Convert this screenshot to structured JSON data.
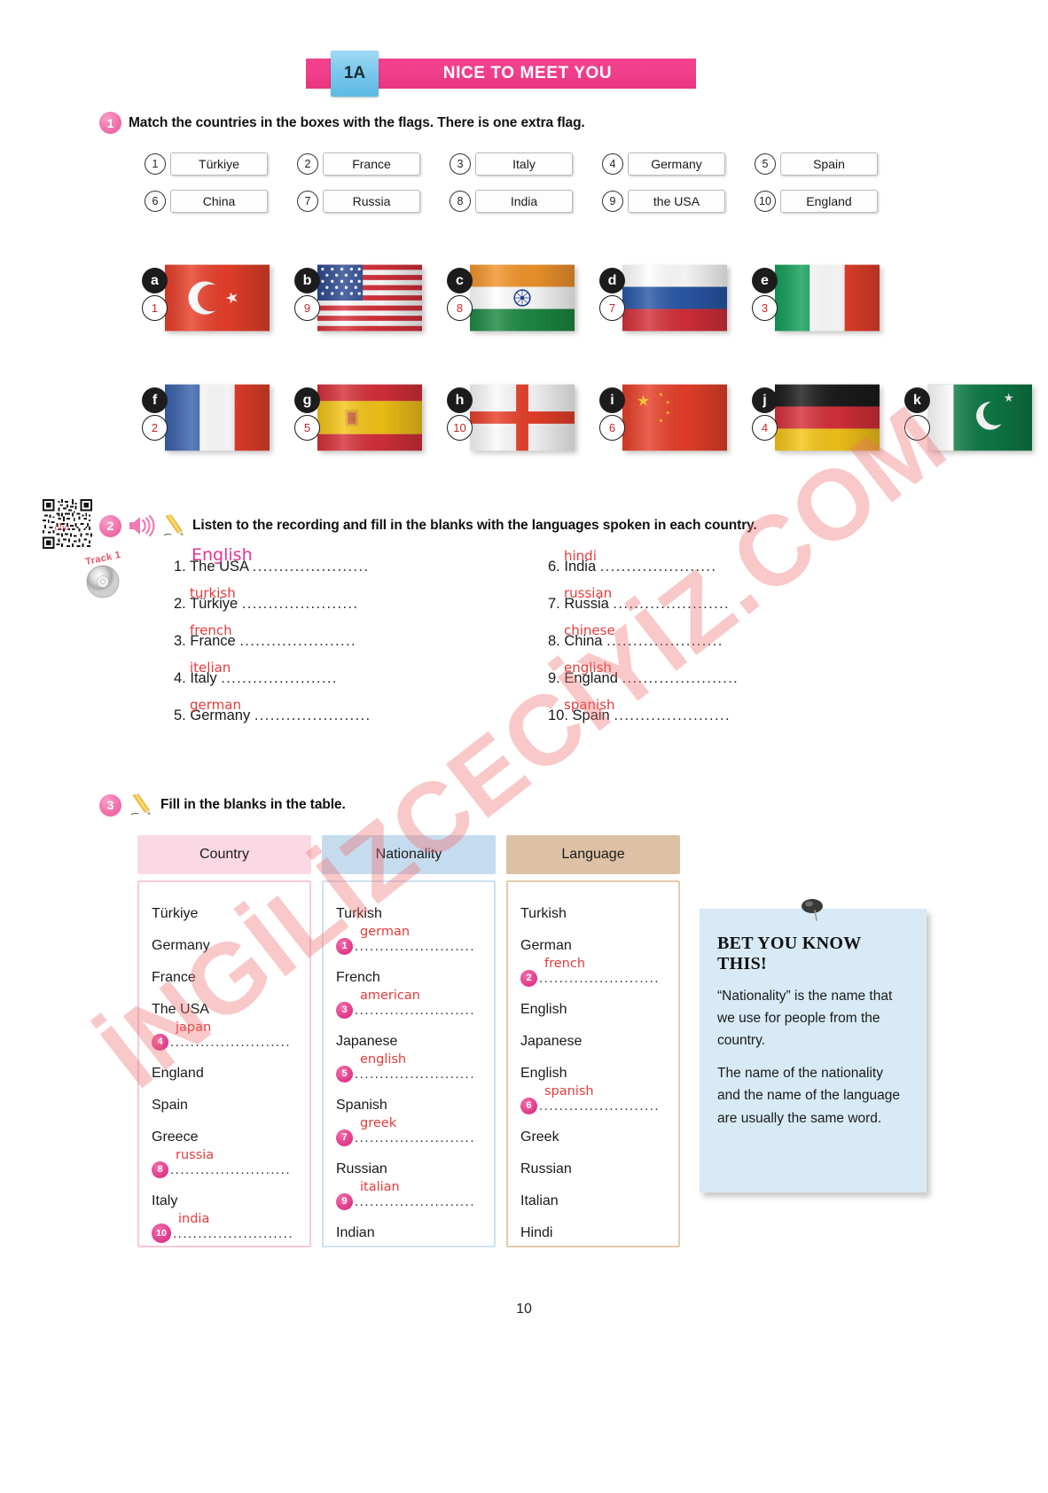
{
  "header": {
    "unit_code": "1A",
    "title": "NICE TO MEET YOU",
    "banner_color": "#ef3e8b",
    "tab_color": "#74c6ea"
  },
  "watermark": {
    "text": "İNGİLİZCECİYİZ.COM",
    "color": "#f06e6e"
  },
  "exercise1": {
    "number": "1",
    "instruction": "Match the countries in the boxes with the flags. There is one extra flag.",
    "countries": [
      {
        "num": "1",
        "name": "Türkiye"
      },
      {
        "num": "2",
        "name": "France"
      },
      {
        "num": "3",
        "name": "Italy"
      },
      {
        "num": "4",
        "name": "Germany"
      },
      {
        "num": "5",
        "name": "Spain"
      },
      {
        "num": "6",
        "name": "China"
      },
      {
        "num": "7",
        "name": "Russia"
      },
      {
        "num": "8",
        "name": "India"
      },
      {
        "num": "9",
        "name": "the USA"
      },
      {
        "num": "10",
        "name": "England"
      }
    ],
    "flags": [
      {
        "letter": "a",
        "answer": "1",
        "country": "turkey-flag"
      },
      {
        "letter": "b",
        "answer": "9",
        "country": "usa-flag"
      },
      {
        "letter": "c",
        "answer": "8",
        "country": "india-flag"
      },
      {
        "letter": "d",
        "answer": "7",
        "country": "russia-flag"
      },
      {
        "letter": "e",
        "answer": "3",
        "country": "italy-flag"
      },
      {
        "letter": "f",
        "answer": "2",
        "country": "france-flag"
      },
      {
        "letter": "g",
        "answer": "5",
        "country": "spain-flag"
      },
      {
        "letter": "h",
        "answer": "10",
        "country": "england-flag"
      },
      {
        "letter": "i",
        "answer": "6",
        "country": "china-flag"
      },
      {
        "letter": "j",
        "answer": "4",
        "country": "germany-flag"
      },
      {
        "letter": "k",
        "answer": "",
        "country": "pakistan-flag"
      }
    ]
  },
  "exercise2": {
    "number": "2",
    "instruction": "Listen to the recording and fill in the blanks with the languages spoken in each country.",
    "track_label": "Track 1",
    "left_items": [
      {
        "num": "1.",
        "country": "The USA",
        "answer": "English",
        "style": "big"
      },
      {
        "num": "2.",
        "country": "Türkiye",
        "answer": "turkish",
        "style": "normal"
      },
      {
        "num": "3.",
        "country": "France",
        "answer": "french",
        "style": "normal"
      },
      {
        "num": "4.",
        "country": "Italy",
        "answer": "itelian",
        "style": "normal"
      },
      {
        "num": "5.",
        "country": "Germany",
        "answer": "german",
        "style": "normal"
      }
    ],
    "right_items": [
      {
        "num": "6.",
        "country": "India",
        "answer": "hindi",
        "style": "normal"
      },
      {
        "num": "7.",
        "country": "Russia",
        "answer": "russian",
        "style": "normal"
      },
      {
        "num": "8.",
        "country": "China",
        "answer": "chinese",
        "style": "normal"
      },
      {
        "num": "9.",
        "country": "England",
        "answer": "english",
        "style": "normal"
      },
      {
        "num": "10.",
        "country": "Spain",
        "answer": "spanish",
        "style": "normal"
      }
    ]
  },
  "exercise3": {
    "number": "3",
    "instruction": "Fill in the blanks in the table.",
    "columns": [
      {
        "header": "Country",
        "color": "#fbd9e4",
        "rows": [
          {
            "text": "Türkiye",
            "blank": false
          },
          {
            "text": "Germany",
            "blank": false
          },
          {
            "text": "France",
            "blank": false
          },
          {
            "text": "The USA",
            "blank": false
          },
          {
            "text": "",
            "blank": true,
            "num": "4",
            "answer": "japan"
          },
          {
            "text": "England",
            "blank": false
          },
          {
            "text": "Spain",
            "blank": false
          },
          {
            "text": "Greece",
            "blank": false
          },
          {
            "text": "",
            "blank": true,
            "num": "8",
            "answer": "russia"
          },
          {
            "text": "Italy",
            "blank": false
          },
          {
            "text": "",
            "blank": true,
            "num": "10",
            "answer": "india"
          }
        ]
      },
      {
        "header": "Nationality",
        "color": "#c5dcee",
        "rows": [
          {
            "text": "Turkish",
            "blank": false
          },
          {
            "text": "",
            "blank": true,
            "num": "1",
            "answer": "german"
          },
          {
            "text": "French",
            "blank": false
          },
          {
            "text": "",
            "blank": true,
            "num": "3",
            "answer": "american"
          },
          {
            "text": "Japanese",
            "blank": false
          },
          {
            "text": "",
            "blank": true,
            "num": "5",
            "answer": "english"
          },
          {
            "text": "Spanish",
            "blank": false
          },
          {
            "text": "",
            "blank": true,
            "num": "7",
            "answer": "greek"
          },
          {
            "text": "Russian",
            "blank": false
          },
          {
            "text": "",
            "blank": true,
            "num": "9",
            "answer": "italian"
          },
          {
            "text": "Indian",
            "blank": false
          }
        ]
      },
      {
        "header": "Language",
        "color": "#ddc1a4",
        "rows": [
          {
            "text": "Turkish",
            "blank": false
          },
          {
            "text": "German",
            "blank": false
          },
          {
            "text": "",
            "blank": true,
            "num": "2",
            "answer": "french"
          },
          {
            "text": "English",
            "blank": false
          },
          {
            "text": "Japanese",
            "blank": false
          },
          {
            "text": "English",
            "blank": false
          },
          {
            "text": "",
            "blank": true,
            "num": "6",
            "answer": "spanish"
          },
          {
            "text": "Greek",
            "blank": false
          },
          {
            "text": "Russian",
            "blank": false
          },
          {
            "text": "Italian",
            "blank": false
          },
          {
            "text": "Hindi",
            "blank": false
          }
        ]
      }
    ]
  },
  "infobox": {
    "title": "BET YOU KNOW THIS!",
    "paragraph1": "“Nationality” is the name that we use for people from the country.",
    "paragraph2": "The name of the nationality and the name of the language are usually the same word."
  },
  "page_number": "10"
}
